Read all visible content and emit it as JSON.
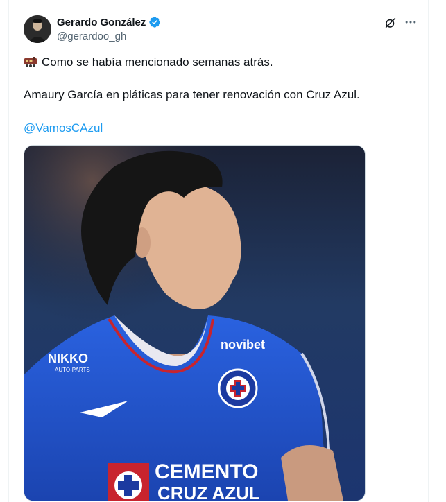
{
  "author": {
    "display_name": "Gerardo González",
    "handle": "@gerardoo_gh",
    "verified": true
  },
  "icons": {
    "avatar": "user-avatar",
    "verified": "verified-badge-icon",
    "grok": "grok-icon",
    "more": "more-options-icon",
    "emoji": "train-emoji-icon"
  },
  "tweet": {
    "line1": "Como se había mencionado semanas atrás.",
    "line2": "Amaury García en pláticas para tener renovación con Cruz Azul.",
    "mention": "@VamosCAzul"
  },
  "media": {
    "kind": "photo",
    "jersey_sponsor": "novibet",
    "jersey_brand": "NIKKO AUTO-PARTS",
    "jersey_text": "CEMENTO CRUZ AZUL"
  },
  "colors": {
    "link": "#1d9bf0",
    "verified": "#1d9bf0",
    "muted": "#536471",
    "jersey_blue": "#1f4fc8"
  }
}
